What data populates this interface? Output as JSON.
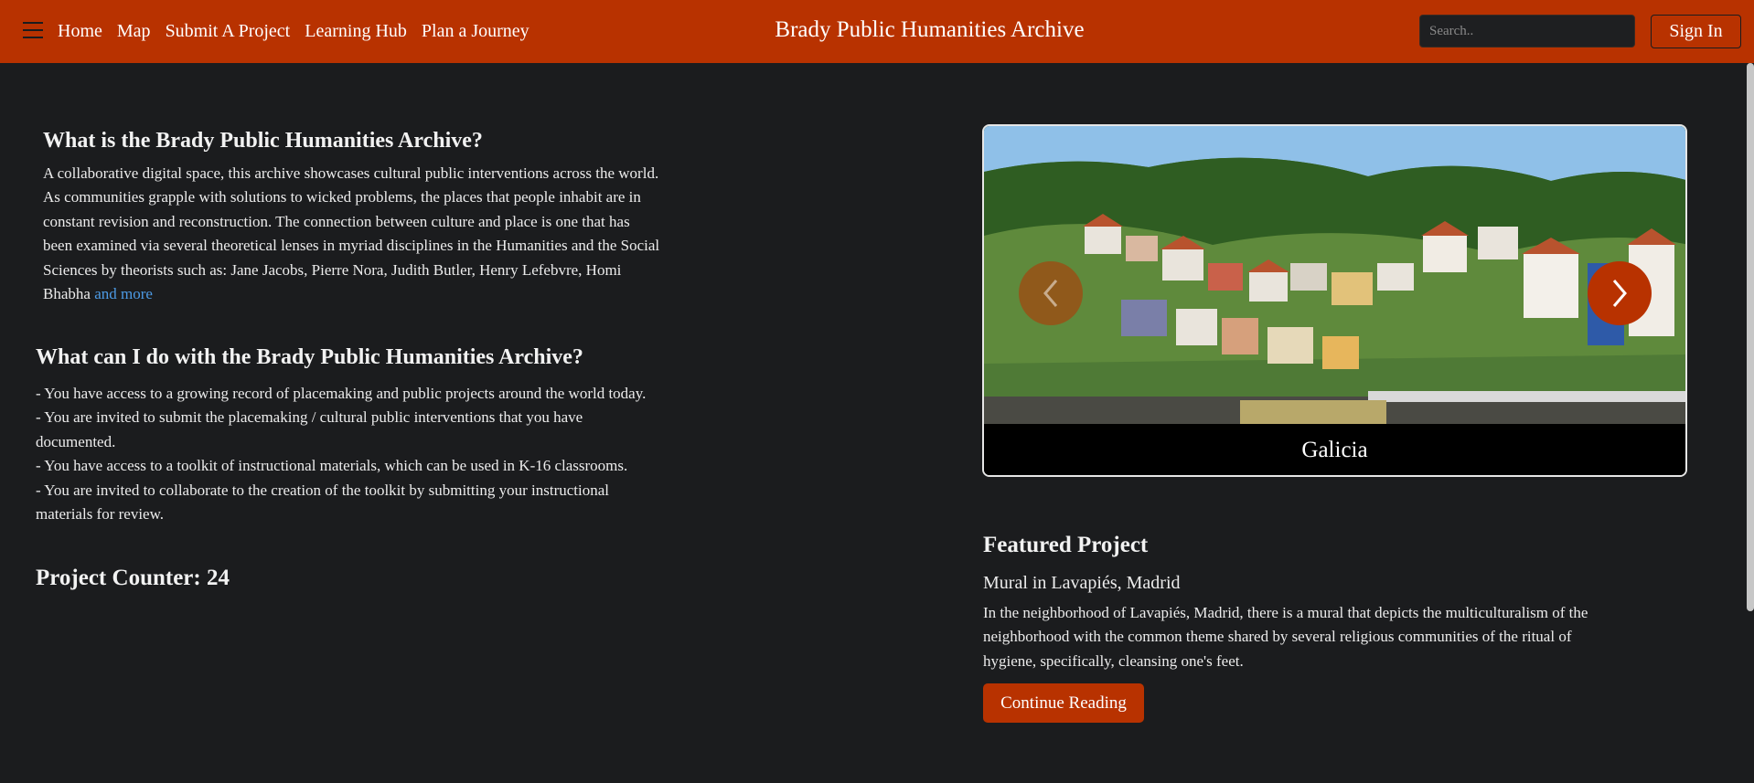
{
  "nav": {
    "links": [
      "Home",
      "Map",
      "Submit A Project",
      "Learning Hub",
      "Plan a Journey"
    ],
    "title": "Brady Public Humanities Archive",
    "search_placeholder": "Search..",
    "sign_in": "Sign In",
    "menu_icon": "hamburger-icon"
  },
  "about": {
    "heading": "What is the Brady Public Humanities Archive?",
    "lines": [
      "A collaborative digital space, this archive showcases cultural public interventions across the world.",
      "As communities grapple with solutions to wicked problems, the places that people inhabit are in",
      "constant revision and reconstruction. The connection between culture and place is one that has",
      "been examined via several theoretical lenses in myriad disciplines in the Humanities and the Social",
      "Sciences by theorists such as: Jane Jacobs, Pierre Nora, Judith Butler, Henry Lefebvre, Homi",
      "Bhabha"
    ],
    "more_link": "and more"
  },
  "usage": {
    "heading": "What can I do with the Brady Public Humanities Archive?",
    "lines": [
      "- You have access to a growing record of placemaking and public projects around the world today.",
      "- You are invited to submit the placemaking / cultural public interventions that you have",
      "documented.",
      "- You have access to a toolkit of instructional materials, which can be used in K-16 classrooms.",
      "- You are invited to collaborate to the creation of the toolkit by submitting your instructional",
      "materials for review."
    ]
  },
  "counter": {
    "label": "Project Counter: 24"
  },
  "carousel": {
    "caption": "Galicia",
    "prev_icon": "chevron-left-icon",
    "next_icon": "chevron-right-icon"
  },
  "featured": {
    "heading": "Featured Project",
    "title": "Mural in Lavapiés, Madrid",
    "lines": [
      "In the neighborhood of Lavapiés, Madrid, there is a mural that depicts the multiculturalism of the",
      "neighborhood with the common theme shared by several religious communities of the ritual of",
      "hygiene, specifically, cleansing one's feet."
    ],
    "button": "Continue Reading"
  },
  "colors": {
    "brand": "#b83200",
    "background": "#1b1c1e",
    "link": "#4d9be6"
  }
}
